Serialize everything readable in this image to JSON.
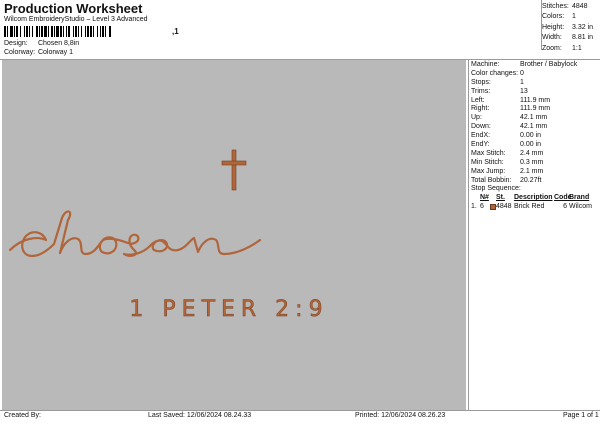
{
  "header": {
    "title": "Production Worksheet",
    "subtitle": "Wilcom EmbroideryStudio – Level 3 Advanced",
    "barcode_text": ",1",
    "design_label": "Design:",
    "design_value": "Chosen 8,8in",
    "colorway_label": "Colorway:",
    "colorway_value": "Colorway 1"
  },
  "stats": [
    {
      "k": "Stitches:",
      "v": "4848"
    },
    {
      "k": "Colors:",
      "v": "1"
    },
    {
      "k": "Height:",
      "v": "3.32 in"
    },
    {
      "k": "Width:",
      "v": "8.81 in"
    },
    {
      "k": "Zoom:",
      "v": "1:1"
    }
  ],
  "design": {
    "word": "chosen",
    "verse": "1 PETER 2:9",
    "thread_color": "#b0653a",
    "background_color": "#b9b9b9"
  },
  "machine_info": [
    {
      "k": "Machine:",
      "v": "Brother / Babylock"
    },
    {
      "k": "Color changes:",
      "v": "0"
    },
    {
      "k": "Stops:",
      "v": "1"
    },
    {
      "k": "Trims:",
      "v": "13"
    },
    {
      "k": "Left:",
      "v": "111.9 mm"
    },
    {
      "k": "Right:",
      "v": "111.9 mm"
    },
    {
      "k": "Up:",
      "v": "42.1 mm"
    },
    {
      "k": "Down:",
      "v": "42.1 mm"
    },
    {
      "k": "EndX:",
      "v": "0.00 in"
    },
    {
      "k": "EndY:",
      "v": "0.00 in"
    },
    {
      "k": "Max Stitch:",
      "v": "2.4 mm"
    },
    {
      "k": "Min Stitch:",
      "v": "0.3 mm"
    },
    {
      "k": "Max Jump:",
      "v": "2.1 mm"
    },
    {
      "k": "Total Bobbin:",
      "v": "20.27ft"
    }
  ],
  "stop_sequence": {
    "label": "Stop Sequence:",
    "headers": {
      "n": "N#",
      "st": "St.",
      "desc": "Description",
      "code": "Code",
      "brand": "Brand"
    },
    "rows": [
      {
        "idx": "1.",
        "n": "6",
        "st": "4848",
        "desc": "Brick Red",
        "code": "6",
        "brand": "Wilcom",
        "color": "#b0653a"
      }
    ]
  },
  "footer": {
    "created_by": "Created By:",
    "last_saved": "Last Saved: 12/06/2024 08.24.33",
    "printed": "Printed: 12/06/2024 08.26.23",
    "page": "Page 1 of 1"
  }
}
